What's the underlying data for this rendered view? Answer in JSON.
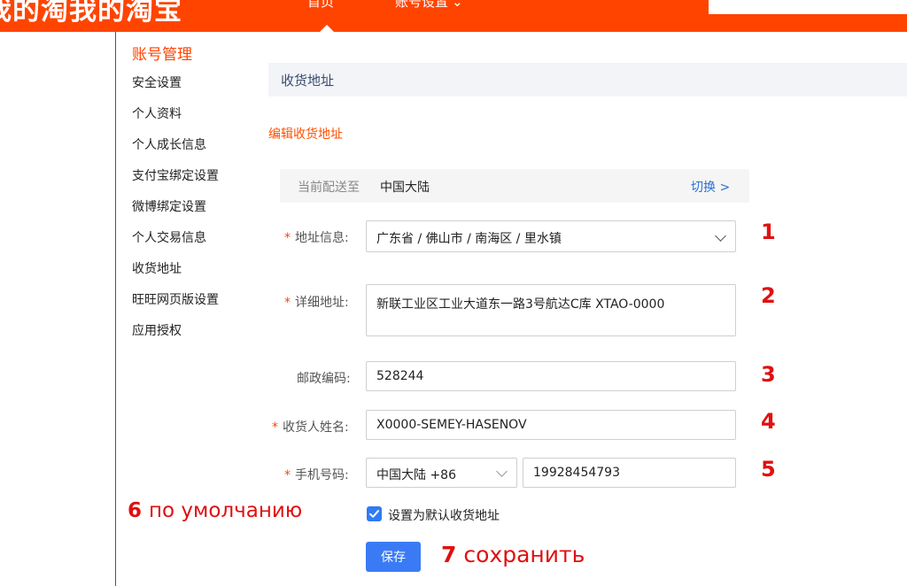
{
  "header": {
    "brand": "我的淘我的淘宝",
    "nav_home": "首页",
    "nav_account": "账号设置",
    "accent_color": "#ff4400"
  },
  "sidebar": {
    "title": "账号管理",
    "items": [
      "安全设置",
      "个人资料",
      "个人成长信息",
      "支付宝绑定设置",
      "微博绑定设置",
      "个人交易信息",
      "收货地址",
      "旺旺网页版设置",
      "应用授权"
    ]
  },
  "section": {
    "title": "收货地址",
    "edit_title": "编辑收货地址"
  },
  "region": {
    "label": "当前配送至",
    "value": "中国大陆",
    "switch_label": "切换 >"
  },
  "form": {
    "required_mark": "*",
    "address_info": {
      "label": "地址信息:",
      "value": "广东省 / 佛山市 / 南海区 / 里水镇"
    },
    "detail_address": {
      "label": "详细地址:",
      "value": "新联工业区工业大道东一路3号航达C库 XTAO-0000"
    },
    "postal_code": {
      "label": "邮政编码:",
      "value": "528244"
    },
    "recipient_name": {
      "label": "收货人姓名:",
      "value": "X0000-SEMEY-HASENOV"
    },
    "phone": {
      "label": "手机号码:",
      "country_code": "中国大陆 +86",
      "value": "19928454793"
    },
    "default_checkbox": {
      "label": "设置为默认收货地址",
      "checked": true
    },
    "save_label": "保存"
  },
  "annotations": {
    "n1": "1",
    "n2": "2",
    "n3": "3",
    "n4": "4",
    "n5": "5",
    "default_num": "6",
    "default_text": "по умолчанию",
    "save_num": "7",
    "save_text": "сохранить",
    "color": "#e01010"
  }
}
